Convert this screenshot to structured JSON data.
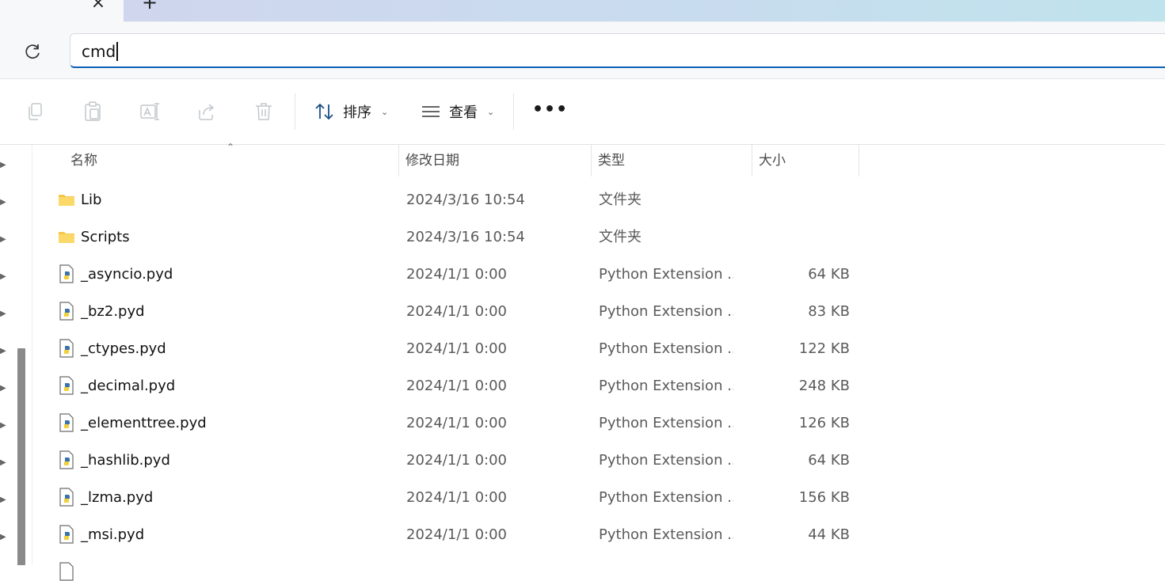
{
  "tabstrip": {
    "close_glyph": "×",
    "new_tab_glyph": "+"
  },
  "addressbar": {
    "value": "cmd"
  },
  "commandbar": {
    "sort_label": "排序",
    "view_label": "查看",
    "more_glyph": "•••",
    "icons": [
      "copy-icon",
      "paste-icon",
      "rename-icon",
      "share-icon",
      "delete-icon",
      "sort-icon",
      "view-list-icon",
      "more-icon"
    ]
  },
  "filelist": {
    "columns": {
      "name": "名称",
      "modified": "修改日期",
      "type": "类型",
      "size": "大小"
    },
    "rows": [
      {
        "name": "Lib",
        "icon": "folder-icon",
        "modified": "2024/3/16 10:54",
        "type": "文件夹",
        "size": ""
      },
      {
        "name": "Scripts",
        "icon": "folder-icon",
        "modified": "2024/3/16 10:54",
        "type": "文件夹",
        "size": ""
      },
      {
        "name": "_asyncio.pyd",
        "icon": "python-file-icon",
        "modified": "2024/1/1 0:00",
        "type": "Python Extension ...",
        "size": "64 KB"
      },
      {
        "name": "_bz2.pyd",
        "icon": "python-file-icon",
        "modified": "2024/1/1 0:00",
        "type": "Python Extension ...",
        "size": "83 KB"
      },
      {
        "name": "_ctypes.pyd",
        "icon": "python-file-icon",
        "modified": "2024/1/1 0:00",
        "type": "Python Extension ...",
        "size": "122 KB"
      },
      {
        "name": "_decimal.pyd",
        "icon": "python-file-icon",
        "modified": "2024/1/1 0:00",
        "type": "Python Extension ...",
        "size": "248 KB"
      },
      {
        "name": "_elementtree.pyd",
        "icon": "python-file-icon",
        "modified": "2024/1/1 0:00",
        "type": "Python Extension ...",
        "size": "126 KB"
      },
      {
        "name": "_hashlib.pyd",
        "icon": "python-file-icon",
        "modified": "2024/1/1 0:00",
        "type": "Python Extension ...",
        "size": "64 KB"
      },
      {
        "name": "_lzma.pyd",
        "icon": "python-file-icon",
        "modified": "2024/1/1 0:00",
        "type": "Python Extension ...",
        "size": "156 KB"
      },
      {
        "name": "_msi.pyd",
        "icon": "python-file-icon",
        "modified": "2024/1/1 0:00",
        "type": "Python Extension ...",
        "size": "44 KB"
      }
    ]
  },
  "colors": {
    "accent": "#0a5fb5",
    "folder": "#f6c64a",
    "python_blue": "#3b73a8",
    "python_yellow": "#f2cf3c"
  }
}
